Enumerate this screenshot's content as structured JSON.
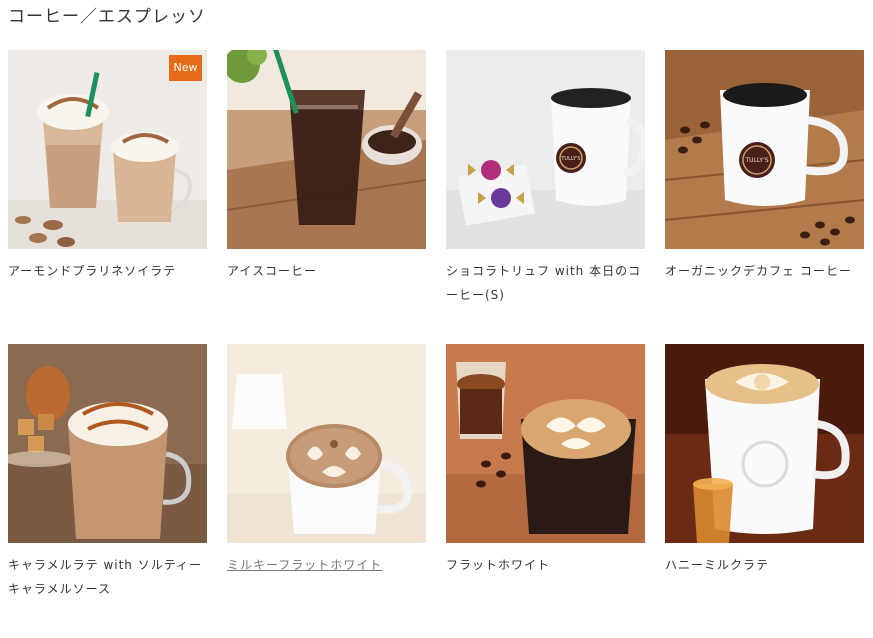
{
  "section": {
    "title": "コーヒー／エスプレッソ"
  },
  "badge_new": "New",
  "colors": {
    "badge": "#e66b18",
    "text": "#333333"
  },
  "products": [
    {
      "name": "アーモンドプラリネソイラテ",
      "badge": true
    },
    {
      "name": "アイスコーヒー",
      "badge": false
    },
    {
      "name": "ショコラトリュフ with 本日のコーヒー(S)",
      "badge": false
    },
    {
      "name": "オーガニックデカフェ コーヒー",
      "badge": false
    },
    {
      "name": "キャラメルラテ with ソルティーキャラメルソース",
      "badge": false
    },
    {
      "name": "ミルキーフラットホワイト",
      "badge": false
    },
    {
      "name": "フラットホワイト",
      "badge": false
    },
    {
      "name": "ハニーミルクラテ",
      "badge": false
    }
  ],
  "logo_text": "TULLY'S"
}
